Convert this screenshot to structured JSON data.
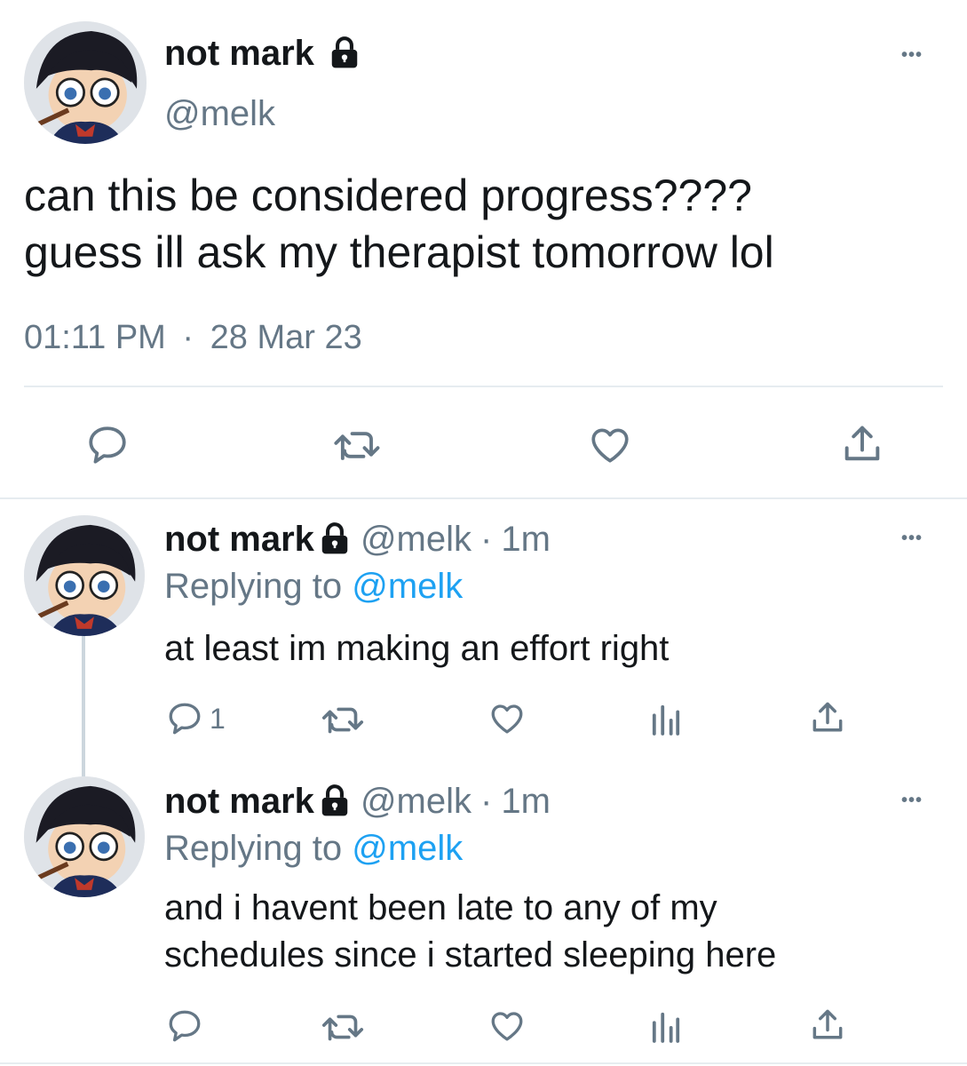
{
  "main_tweet": {
    "display_name": "not mark",
    "handle": "@melk",
    "text_line1": "can this be considered progress????",
    "text_line2": "guess ill ask my therapist tomorrow lol",
    "time": "01:11 PM",
    "separator": "·",
    "date": "28 Mar 23"
  },
  "replies": [
    {
      "display_name": "not mark",
      "handle": "@melk",
      "sep": "·",
      "age": "1m",
      "replying_prefix": "Replying to",
      "replying_handle": "@melk",
      "text_line1": "at least im making an effort right",
      "text_line2": "",
      "reply_count": "1"
    },
    {
      "display_name": "not mark",
      "handle": "@melk",
      "sep": "·",
      "age": "1m",
      "replying_prefix": "Replying to",
      "replying_handle": "@melk",
      "text_line1": "and i havent been late to any of my",
      "text_line2": "schedules since i started sleeping here",
      "reply_count": ""
    }
  ],
  "more_glyph": "•••",
  "icons": [
    "reply-icon",
    "retweet-icon",
    "like-icon",
    "share-icon",
    "analytics-icon",
    "lock-icon",
    "more-icon"
  ],
  "colors": {
    "text": "#14171a",
    "muted": "#657786",
    "link": "#1da1f2",
    "divider": "#e6ecf0"
  }
}
